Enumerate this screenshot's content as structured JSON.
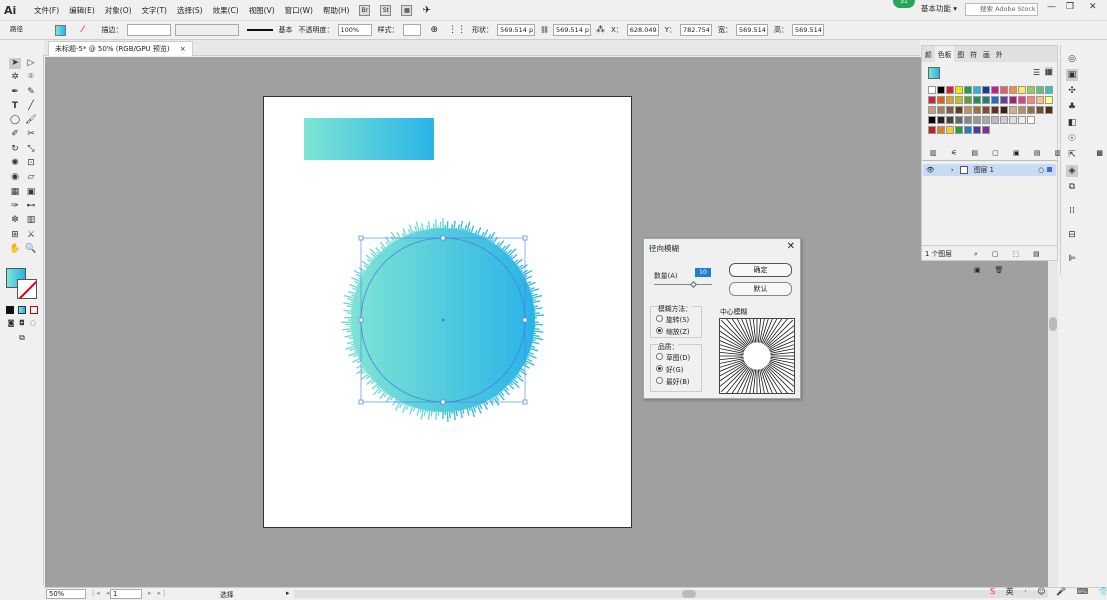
{
  "menu": {
    "logo": "Ai",
    "items": [
      "文件(F)",
      "编辑(E)",
      "对象(O)",
      "文字(T)",
      "选择(S)",
      "效果(C)",
      "视图(V)",
      "窗口(W)",
      "帮助(H)"
    ],
    "workspace": "基本功能",
    "badge": "31",
    "search_placeholder": "搜索 Adobe Stock"
  },
  "control": {
    "path_label": "路径",
    "stroke_label": "描边：",
    "style_label": "基本",
    "opacity_label": "不透明度：",
    "opacity_value": "100%",
    "graphic_style_label": "样式：",
    "shape_label": "形状：",
    "w_value": "569.514 p",
    "h_value": "569.514 p",
    "x_label": "X：",
    "x_value": "628.049",
    "y_label": "Y：",
    "y_value": "782.754",
    "width_label": "宽：",
    "width_value": "569.514",
    "height_label": "高：",
    "height_value": "569.514"
  },
  "document": {
    "tab_label": "未标题-5* @ 50% (RGB/GPU 预览)",
    "close": "×"
  },
  "dialog": {
    "title": "径向模糊",
    "amount_label": "数量(A)",
    "amount_value": "10",
    "ok_label": "确定",
    "reset_label": "默认",
    "method_label": "模糊方法：",
    "method_options": [
      "旋转(S)",
      "缩放(Z)"
    ],
    "quality_label": "品质：",
    "quality_options": [
      "草图(D)",
      "好(G)",
      "最好(B)"
    ],
    "center_label": "中心模糊",
    "selected_method": 1,
    "selected_quality": 1
  },
  "panel": {
    "tabs": [
      "颜",
      "色板",
      "图",
      "符",
      "画",
      "外"
    ],
    "active_tab": 1,
    "layer_name": "图层 1",
    "layer_count": "1 个图层"
  },
  "status": {
    "zoom": "50%",
    "page": "1",
    "mode": "选择"
  },
  "colors": {
    "gradient_start": "#7ee4d4",
    "gradient_end": "#2ab3e8",
    "selection": "#4a7fe0",
    "badge": "#26a65b"
  }
}
